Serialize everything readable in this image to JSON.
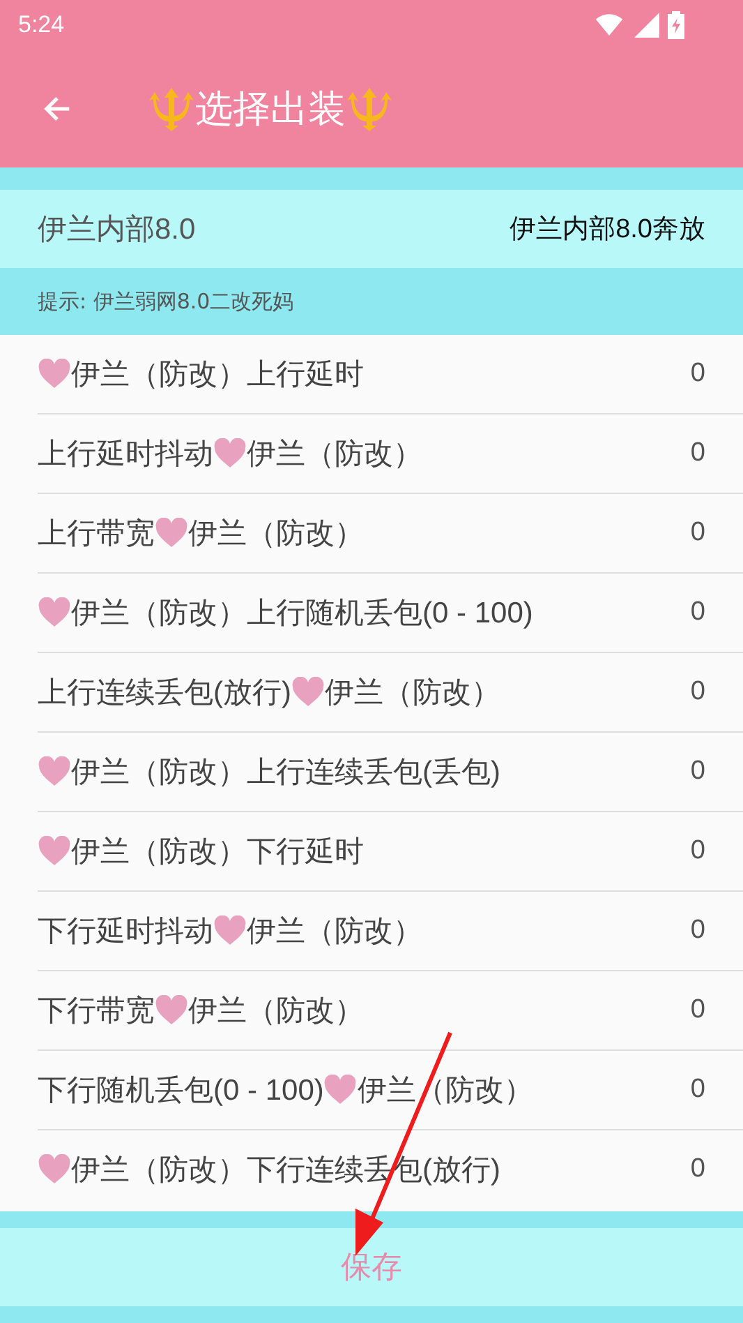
{
  "status_bar": {
    "time": "5:24"
  },
  "app_bar": {
    "title": "选择出装"
  },
  "header": {
    "name": "伊兰内部8.0",
    "value": "伊兰内部8.0奔放"
  },
  "hint": "提示: 伊兰弱网8.0二改死妈",
  "settings": [
    {
      "after": "伊兰（防改）上行延时",
      "value": "0"
    },
    {
      "before": "上行延时抖动",
      "after": "伊兰（防改）",
      "value": "0"
    },
    {
      "before": "上行带宽",
      "after": "伊兰（防改）",
      "value": "0"
    },
    {
      "after": "伊兰（防改）上行随机丢包(0 - 100)",
      "value": "0"
    },
    {
      "before": "上行连续丢包(放行)",
      "after": "伊兰（防改）",
      "value": "0"
    },
    {
      "after": "伊兰（防改）上行连续丢包(丢包)",
      "value": "0"
    },
    {
      "after": "伊兰（防改）下行延时",
      "value": "0"
    },
    {
      "before": "下行延时抖动",
      "after": "伊兰（防改）",
      "value": "0"
    },
    {
      "before": "下行带宽",
      "after": "伊兰（防改）",
      "value": "0"
    },
    {
      "before": "下行随机丢包(0 - 100)",
      "after": "伊兰（防改）",
      "value": "0"
    },
    {
      "after": "伊兰（防改）下行连续丢包(放行)",
      "value": "0"
    }
  ],
  "save_button": "保存"
}
